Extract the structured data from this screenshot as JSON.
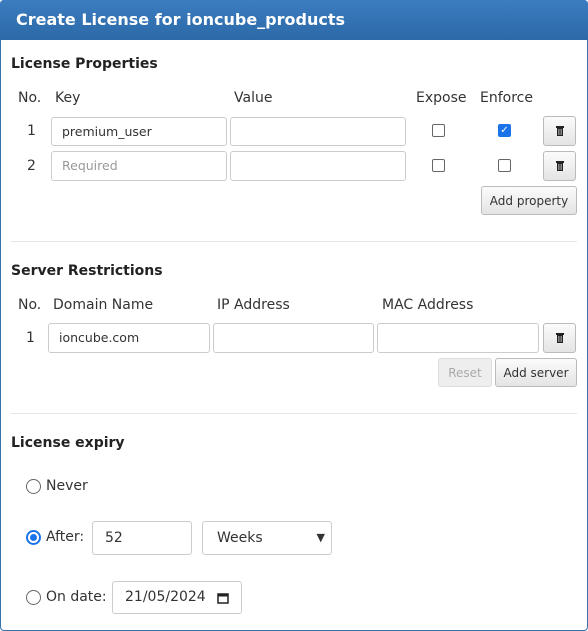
{
  "title": "Create License for ioncube_products",
  "properties": {
    "heading": "License Properties",
    "columns": {
      "no": "No.",
      "key": "Key",
      "value": "Value",
      "expose": "Expose",
      "enforce": "Enforce"
    },
    "rows": [
      {
        "no": "1",
        "key": "premium_user",
        "key_placeholder": "",
        "value": "",
        "expose": false,
        "enforce": true
      },
      {
        "no": "2",
        "key": "",
        "key_placeholder": "Required",
        "value": "",
        "expose": false,
        "enforce": false
      }
    ],
    "add_label": "Add property"
  },
  "servers": {
    "heading": "Server Restrictions",
    "columns": {
      "no": "No.",
      "domain": "Domain Name",
      "ip": "IP Address",
      "mac": "MAC Address"
    },
    "rows": [
      {
        "no": "1",
        "domain": "ioncube.com",
        "ip": "",
        "mac": ""
      }
    ],
    "reset_label": "Reset",
    "add_label": "Add server"
  },
  "expiry": {
    "heading": "License expiry",
    "never_label": "Never",
    "after_label": "After:",
    "after_value": "52",
    "after_unit": "Weeks",
    "ondate_label": "On date:",
    "date_value": "21/05/2024",
    "selected": "after"
  },
  "colors": {
    "header": "#2f6eac",
    "accent": "#1a73e8"
  }
}
